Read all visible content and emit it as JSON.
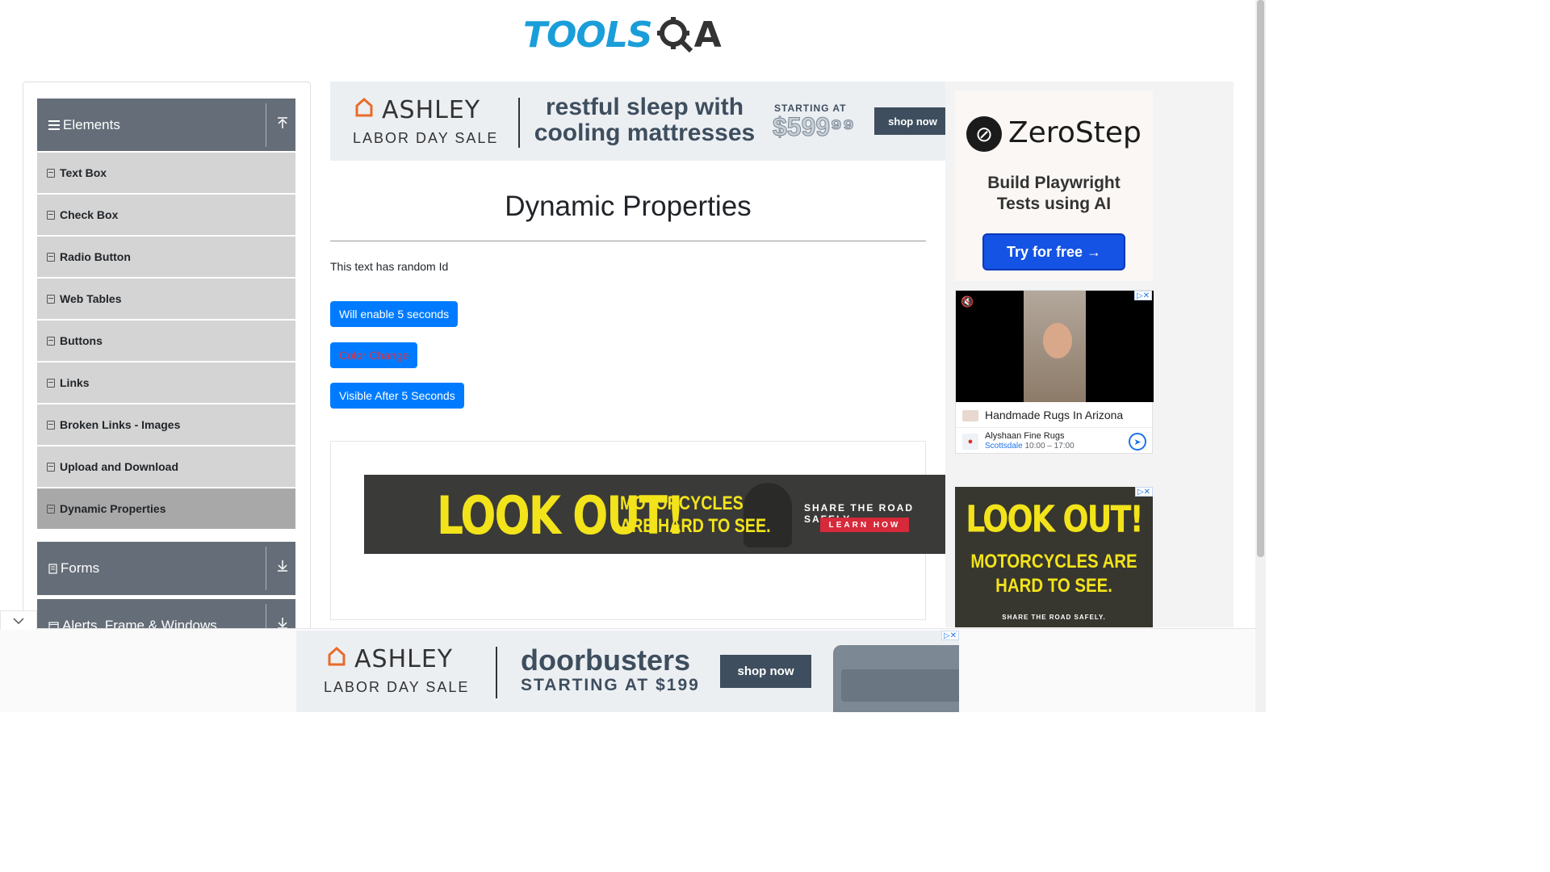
{
  "header": {
    "logo_tools": "TOOLS",
    "logo_qa": "A"
  },
  "sidebar": {
    "groups": [
      {
        "label": "Elements"
      },
      {
        "label": "Forms"
      },
      {
        "label": "Alerts, Frame & Windows"
      }
    ],
    "items": [
      {
        "label": "Text Box"
      },
      {
        "label": "Check Box"
      },
      {
        "label": "Radio Button"
      },
      {
        "label": "Web Tables"
      },
      {
        "label": "Buttons"
      },
      {
        "label": "Links"
      },
      {
        "label": "Broken Links - Images"
      },
      {
        "label": "Upload and Download"
      },
      {
        "label": "Dynamic Properties"
      }
    ],
    "active_item": "Dynamic Properties"
  },
  "main": {
    "title": "Dynamic Properties",
    "random_text": "This text has random Id",
    "buttons": {
      "enable_after": "Will enable 5 seconds",
      "color_change": "Color Change",
      "visible_after": "Visible After 5 Seconds"
    }
  },
  "ads": {
    "ashley_top": {
      "brand": "ASHLEY",
      "sale": "LABOR DAY SALE",
      "headline_1": "restful sleep with",
      "headline_2": "cooling mattresses",
      "starting": "STARTING AT",
      "price": "$599⁹⁹",
      "cta": "shop now"
    },
    "moto_banner": {
      "look": "LOOK OUT!",
      "line1": "MOTORCYCLES",
      "line2": "ARE HARD TO SEE.",
      "share": "SHARE THE ROAD SAFELY.",
      "learn": "LEARN HOW"
    },
    "zerostep": {
      "name": "ZeroStep",
      "tagline_1": "Build Playwright",
      "tagline_2": "Tests using AI",
      "cta": "Try for free →"
    },
    "video_ad": {
      "title": "Handmade Rugs In Arizona",
      "business": "Alyshaan Fine Rugs",
      "city": "Scottsdale",
      "hours": "10:00 – 17:00"
    },
    "moto_side": {
      "look": "LOOK OUT!",
      "line1": "MOTORCYCLES ARE",
      "line2": "HARD TO SEE.",
      "share": "SHARE THE ROAD SAFELY."
    },
    "ashley_bottom": {
      "brand": "ASHLEY",
      "sale": "LABOR DAY SALE",
      "headline": "doorbusters",
      "starting": "STARTING AT $199",
      "cta": "shop now"
    }
  },
  "colors": {
    "primary_button": "#007bff",
    "sidebar_header": "#656e78",
    "sidebar_item": "#d4d4d4",
    "logo_blue": "#1a9ed9"
  }
}
